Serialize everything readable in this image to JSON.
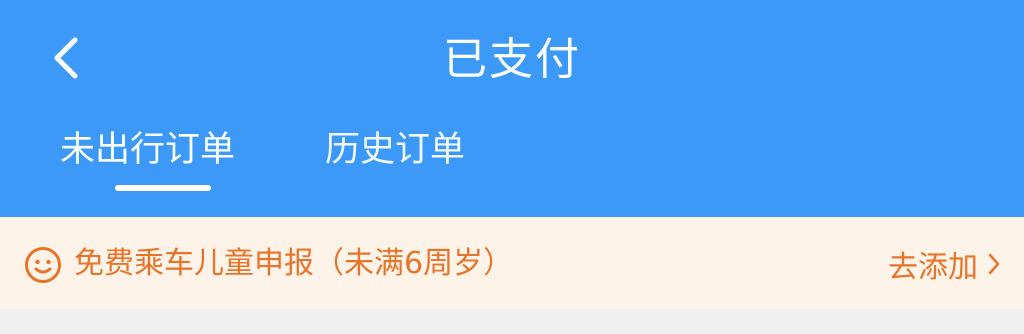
{
  "header": {
    "title": "已支付",
    "back_icon": "chevron-left-icon",
    "background_color": "#3d99f7"
  },
  "tabs": [
    {
      "label": "未出行订单",
      "active": true
    },
    {
      "label": "历史订单",
      "active": false
    }
  ],
  "notice": {
    "icon": "smile-icon",
    "text": "免费乘车儿童申报（未满6周岁）",
    "action_label": "去添加",
    "action_icon": "chevron-right-icon",
    "text_color": "#e8742a",
    "background_color": "#fdf3e8"
  }
}
